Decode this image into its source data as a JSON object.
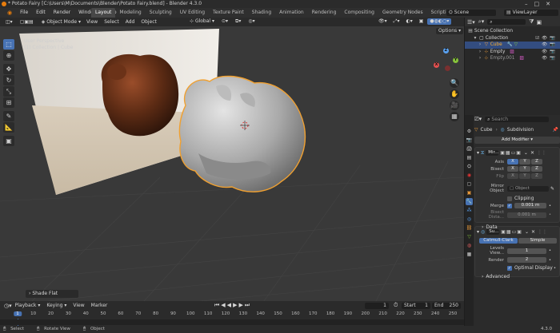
{
  "window": {
    "title": "* Potato Fairy [C:\\Users\\M\\Documents\\Blender\\Potato Fairy.blend] - Blender 4.3.0"
  },
  "topbar": {
    "menus": [
      "File",
      "Edit",
      "Render",
      "Window",
      "Help"
    ],
    "workspaces": [
      "Layout",
      "Modeling",
      "Sculpting",
      "UV Editing",
      "Texture Paint",
      "Shading",
      "Animation",
      "Rendering",
      "Compositing",
      "Geometry Nodes",
      "Scripting"
    ],
    "active_workspace": "Layout",
    "scene": "Scene",
    "view_layer": "ViewLayer"
  },
  "viewport": {
    "mode": "Object Mode",
    "menus": [
      "View",
      "Select",
      "Add",
      "Object"
    ],
    "transform_orientation": "Global",
    "options_label": "Options",
    "overlay_text": [
      "User Perspective",
      "(1) Collection | Cube"
    ],
    "last_operator": "Shade Flat",
    "gizmo_axes": [
      "X",
      "Y",
      "Z"
    ]
  },
  "timeline": {
    "menus": [
      "Playback",
      "Keying",
      "View",
      "Marker"
    ],
    "current_frame": "1",
    "start_label": "Start",
    "start": "1",
    "end_label": "End",
    "end": "250",
    "ticks": [
      "1",
      "10",
      "20",
      "30",
      "40",
      "50",
      "60",
      "70",
      "80",
      "90",
      "100",
      "110",
      "120",
      "130",
      "140",
      "150",
      "160",
      "170",
      "180",
      "190",
      "200",
      "210",
      "220",
      "230",
      "240",
      "250"
    ]
  },
  "statusbar": {
    "items": [
      "Select",
      "Rotate View",
      "Object"
    ],
    "version": "4.3.0"
  },
  "outliner": {
    "items": [
      {
        "label": "Scene Collection"
      },
      {
        "label": "Collection"
      },
      {
        "label": "Cube"
      },
      {
        "label": "Empty"
      },
      {
        "label": "Empty.001"
      }
    ]
  },
  "properties": {
    "search_placeholder": "Search",
    "breadcrumb_object": "Cube",
    "breadcrumb_modifier": "Subdivision",
    "add_modifier": "Add Modifier",
    "mirror": {
      "name": "Mir...",
      "axis_label": "Axis",
      "bisect_label": "Bisect",
      "flip_label": "Flip",
      "axes": [
        "X",
        "Y",
        "Z"
      ],
      "mirror_object_label": "Mirror Object",
      "mirror_object_placeholder": "Object",
      "clipping_label": "Clipping",
      "merge_label": "Merge",
      "merge_value": "0.001 m",
      "bisect_distance_label": "Bisect Dista...",
      "bisect_distance_value": "0.001 m",
      "data_label": "Data"
    },
    "subdivision": {
      "name": "Su...",
      "catmull_clark": "Catmull-Clark",
      "simple": "Simple",
      "levels_viewport_label": "Levels View...",
      "levels_viewport": "1",
      "render_label": "Render",
      "render": "2",
      "optimal_display": "Optimal Display",
      "advanced": "Advanced"
    }
  }
}
